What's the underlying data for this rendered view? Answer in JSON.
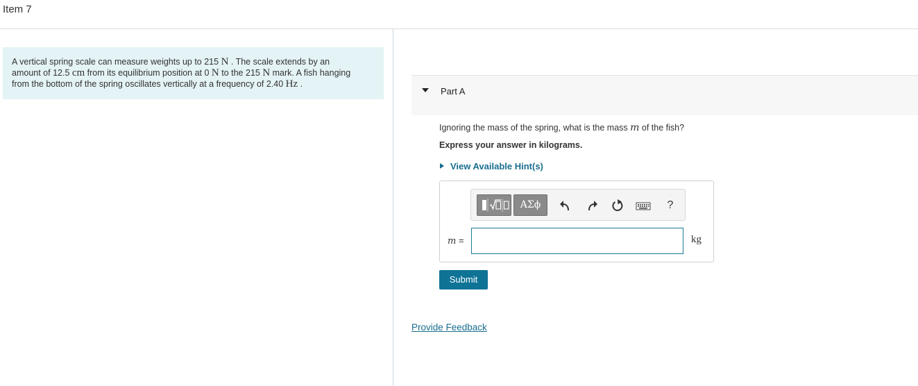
{
  "header": {
    "title": "Item 7"
  },
  "problem": {
    "line1_pre": "A vertical spring scale can measure weights up to 215 ",
    "unit_N": "N",
    "line1_post": " . The scale extends by an",
    "line2_pre": "amount of 12.5 ",
    "unit_cm": "cm",
    "line2_mid": " from its equilibrium position at 0 ",
    "line2_mid2": " to the 215 ",
    "line2_post": " mark. A fish hanging",
    "line3_pre": "from the bottom of the spring oscillates vertically at a frequency of 2.40 ",
    "unit_Hz": "Hz",
    "line3_post": " ."
  },
  "part": {
    "label": "Part A"
  },
  "question": {
    "pre": "Ignoring the mass of the spring, what is the mass ",
    "var": "m",
    "post": " of the fish?"
  },
  "instructions": "Express your answer in kilograms.",
  "hint_link": "View Available Hint(s)",
  "toolbar": {
    "greek_label": "ΑΣϕ",
    "help_label": "?",
    "icons": [
      "templates-icon",
      "greek-letters-icon",
      "undo-icon",
      "redo-icon",
      "reset-icon",
      "keyboard-icon",
      "help-icon"
    ]
  },
  "answer": {
    "variable": "m",
    "equals": " =",
    "value": "",
    "unit": "kg"
  },
  "submit_label": "Submit",
  "feedback_link": "Provide Feedback",
  "colors": {
    "problem_bg": "#e4f3f5",
    "accent": "#0f7396",
    "link": "#1a6e8f",
    "toolbar_button": "#8a8a8a"
  }
}
